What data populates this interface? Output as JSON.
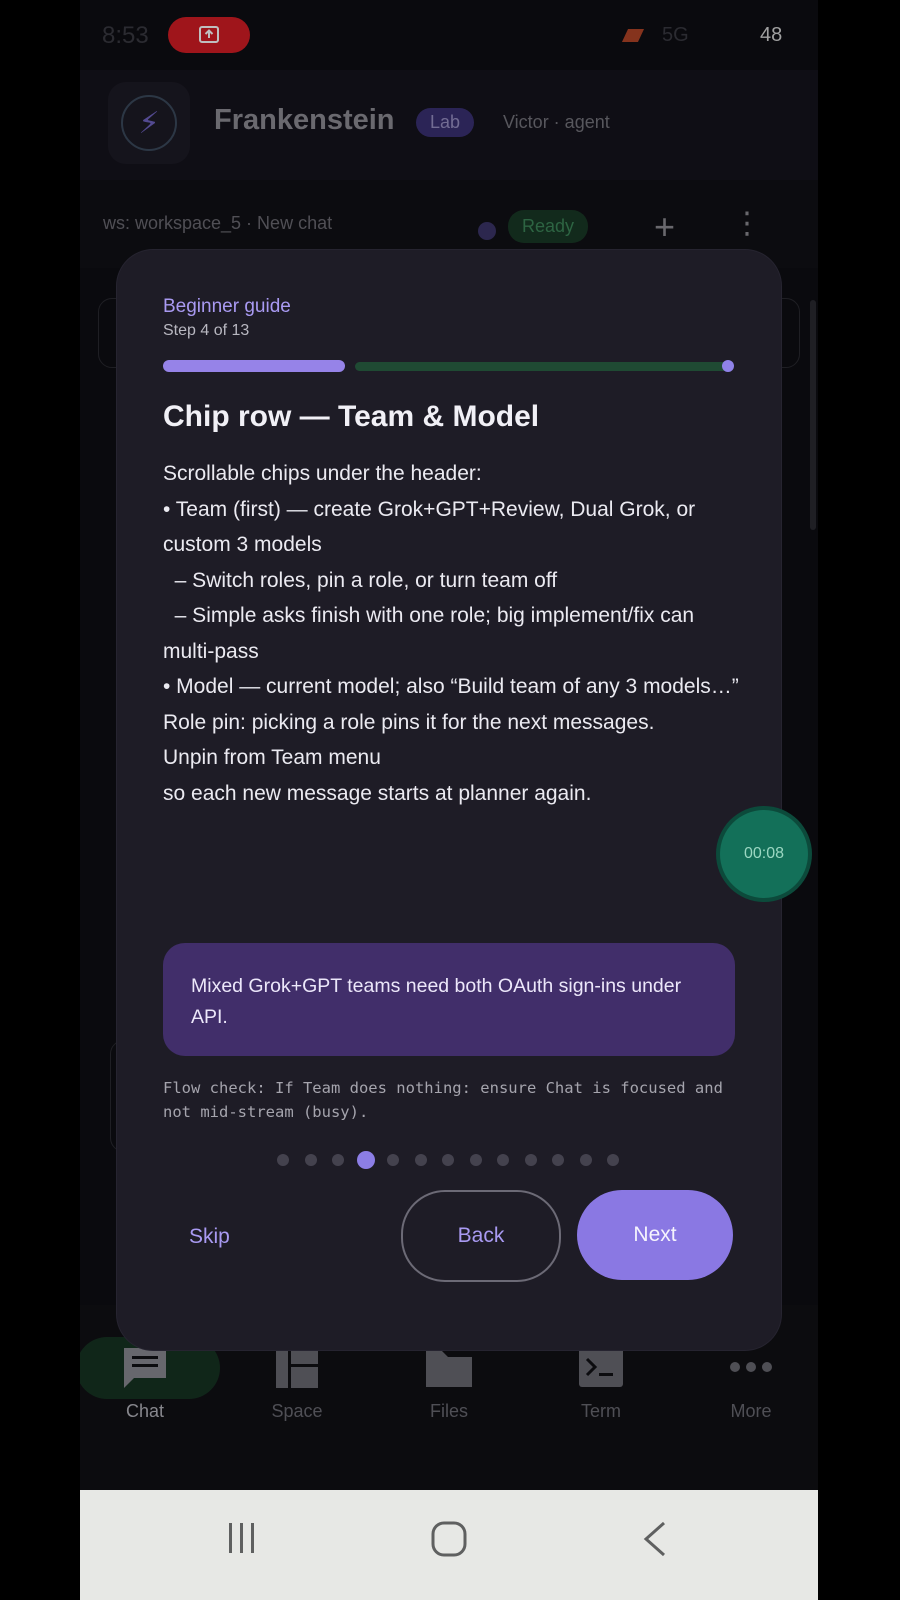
{
  "status_bar": {
    "time": "8:53",
    "network": "5G",
    "battery": "48"
  },
  "header": {
    "app_title": "Frankenstein",
    "badge": "Lab",
    "user": "Victor · agent"
  },
  "workspace_bar": {
    "label": "ws: workspace_5 · New chat",
    "status": "Ready",
    "add_label": "+",
    "more_label": "⋮"
  },
  "guide": {
    "label": "Beginner guide",
    "step": "Step 4 of 13",
    "current_step": 4,
    "total_steps": 13,
    "title": "Chip row — Team & Model",
    "body": [
      "Scrollable chips under the header:",
      "",
      "• Team (first) — create Grok+GPT+Review, Dual Grok, or custom 3 models",
      "  – Switch roles, pin a role, or turn team off",
      "  – Simple asks finish with one role; big implement/fix can multi-pass",
      "• Model — current model; also “Build team of any 3 models…”",
      "",
      "Role pin: picking a role pins it for the next messages.",
      "Unpin from Team menu",
      "so each new message starts at planner again."
    ],
    "callout": "Mixed Grok+GPT teams need both OAuth sign-ins under API.",
    "flow_check": "Flow check: If Team does nothing: ensure Chat is focused and not mid-stream (busy).",
    "skip_label": "Skip",
    "back_label": "Back",
    "next_label": "Next"
  },
  "timer": "00:08",
  "bottom_nav": [
    {
      "label": "Chat",
      "icon": "chat-icon",
      "active": true
    },
    {
      "label": "Space",
      "icon": "space-icon",
      "active": false
    },
    {
      "label": "Files",
      "icon": "folder-icon",
      "active": false
    },
    {
      "label": "Term",
      "icon": "terminal-icon",
      "active": false
    },
    {
      "label": "More",
      "icon": "more-icon",
      "active": false
    }
  ]
}
